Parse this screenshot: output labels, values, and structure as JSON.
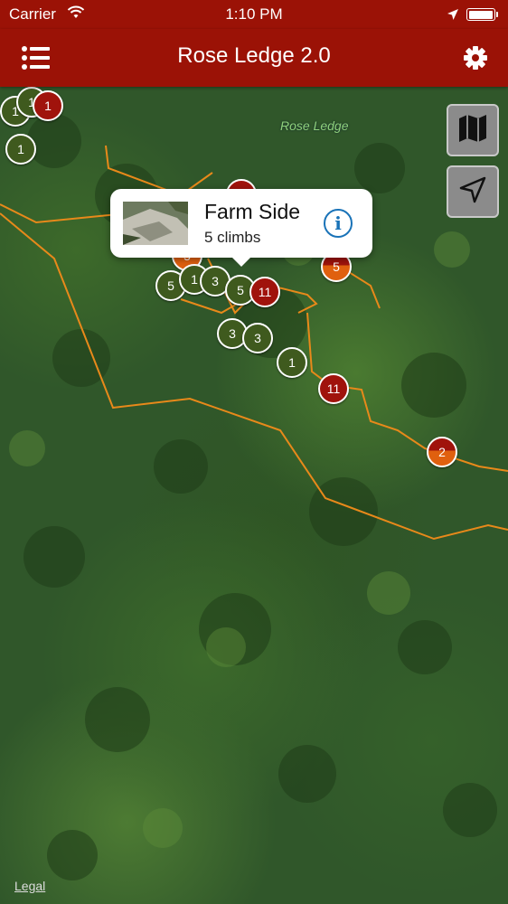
{
  "status_bar": {
    "carrier": "Carrier",
    "time": "1:10 PM",
    "icons": [
      "wifi-icon",
      "location-arrow-icon",
      "battery-icon"
    ]
  },
  "nav_bar": {
    "title": "Rose Ledge 2.0",
    "left_icon": "list-icon",
    "right_icon": "gear-icon"
  },
  "map": {
    "place_label": "Rose Ledge",
    "legal_link": "Legal",
    "controls": [
      "map-layers-icon",
      "location-arrow-icon"
    ],
    "trail_color": "#e8891a",
    "markers": [
      {
        "label": "1"
      },
      {
        "label": "1"
      },
      {
        "label": "1"
      },
      {
        "label": "1"
      },
      {
        "label": "5"
      },
      {
        "label": "5"
      },
      {
        "label": "1"
      },
      {
        "label": "3"
      },
      {
        "label": "5"
      },
      {
        "label": "11"
      },
      {
        "label": "3"
      },
      {
        "label": "3"
      },
      {
        "label": "1"
      },
      {
        "label": "11"
      },
      {
        "label": "2"
      }
    ]
  },
  "callout": {
    "name": "Farm Side",
    "subtitle": "5 climbs",
    "info_icon": "info-icon"
  },
  "colors": {
    "nav_bg": "#9b1206",
    "marker_green": "#3f5a1e",
    "marker_red": "#a0130c",
    "marker_orange": "#e0600f",
    "info_blue": "#1a73b8"
  }
}
